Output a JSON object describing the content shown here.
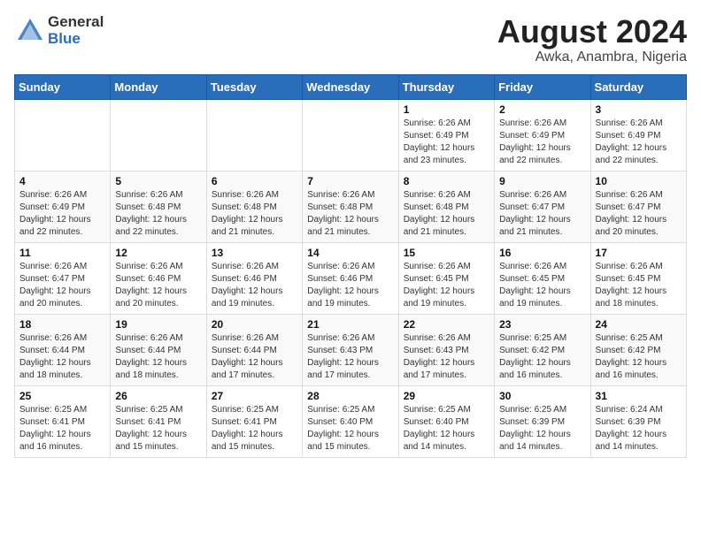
{
  "header": {
    "logo_general": "General",
    "logo_blue": "Blue",
    "title": "August 2024",
    "subtitle": "Awka, Anambra, Nigeria"
  },
  "days_of_week": [
    "Sunday",
    "Monday",
    "Tuesday",
    "Wednesday",
    "Thursday",
    "Friday",
    "Saturday"
  ],
  "weeks": [
    [
      {
        "day": "",
        "info": ""
      },
      {
        "day": "",
        "info": ""
      },
      {
        "day": "",
        "info": ""
      },
      {
        "day": "",
        "info": ""
      },
      {
        "day": "1",
        "info": "Sunrise: 6:26 AM\nSunset: 6:49 PM\nDaylight: 12 hours\nand 23 minutes."
      },
      {
        "day": "2",
        "info": "Sunrise: 6:26 AM\nSunset: 6:49 PM\nDaylight: 12 hours\nand 22 minutes."
      },
      {
        "day": "3",
        "info": "Sunrise: 6:26 AM\nSunset: 6:49 PM\nDaylight: 12 hours\nand 22 minutes."
      }
    ],
    [
      {
        "day": "4",
        "info": "Sunrise: 6:26 AM\nSunset: 6:49 PM\nDaylight: 12 hours\nand 22 minutes."
      },
      {
        "day": "5",
        "info": "Sunrise: 6:26 AM\nSunset: 6:48 PM\nDaylight: 12 hours\nand 22 minutes."
      },
      {
        "day": "6",
        "info": "Sunrise: 6:26 AM\nSunset: 6:48 PM\nDaylight: 12 hours\nand 21 minutes."
      },
      {
        "day": "7",
        "info": "Sunrise: 6:26 AM\nSunset: 6:48 PM\nDaylight: 12 hours\nand 21 minutes."
      },
      {
        "day": "8",
        "info": "Sunrise: 6:26 AM\nSunset: 6:48 PM\nDaylight: 12 hours\nand 21 minutes."
      },
      {
        "day": "9",
        "info": "Sunrise: 6:26 AM\nSunset: 6:47 PM\nDaylight: 12 hours\nand 21 minutes."
      },
      {
        "day": "10",
        "info": "Sunrise: 6:26 AM\nSunset: 6:47 PM\nDaylight: 12 hours\nand 20 minutes."
      }
    ],
    [
      {
        "day": "11",
        "info": "Sunrise: 6:26 AM\nSunset: 6:47 PM\nDaylight: 12 hours\nand 20 minutes."
      },
      {
        "day": "12",
        "info": "Sunrise: 6:26 AM\nSunset: 6:46 PM\nDaylight: 12 hours\nand 20 minutes."
      },
      {
        "day": "13",
        "info": "Sunrise: 6:26 AM\nSunset: 6:46 PM\nDaylight: 12 hours\nand 19 minutes."
      },
      {
        "day": "14",
        "info": "Sunrise: 6:26 AM\nSunset: 6:46 PM\nDaylight: 12 hours\nand 19 minutes."
      },
      {
        "day": "15",
        "info": "Sunrise: 6:26 AM\nSunset: 6:45 PM\nDaylight: 12 hours\nand 19 minutes."
      },
      {
        "day": "16",
        "info": "Sunrise: 6:26 AM\nSunset: 6:45 PM\nDaylight: 12 hours\nand 19 minutes."
      },
      {
        "day": "17",
        "info": "Sunrise: 6:26 AM\nSunset: 6:45 PM\nDaylight: 12 hours\nand 18 minutes."
      }
    ],
    [
      {
        "day": "18",
        "info": "Sunrise: 6:26 AM\nSunset: 6:44 PM\nDaylight: 12 hours\nand 18 minutes."
      },
      {
        "day": "19",
        "info": "Sunrise: 6:26 AM\nSunset: 6:44 PM\nDaylight: 12 hours\nand 18 minutes."
      },
      {
        "day": "20",
        "info": "Sunrise: 6:26 AM\nSunset: 6:44 PM\nDaylight: 12 hours\nand 17 minutes."
      },
      {
        "day": "21",
        "info": "Sunrise: 6:26 AM\nSunset: 6:43 PM\nDaylight: 12 hours\nand 17 minutes."
      },
      {
        "day": "22",
        "info": "Sunrise: 6:26 AM\nSunset: 6:43 PM\nDaylight: 12 hours\nand 17 minutes."
      },
      {
        "day": "23",
        "info": "Sunrise: 6:25 AM\nSunset: 6:42 PM\nDaylight: 12 hours\nand 16 minutes."
      },
      {
        "day": "24",
        "info": "Sunrise: 6:25 AM\nSunset: 6:42 PM\nDaylight: 12 hours\nand 16 minutes."
      }
    ],
    [
      {
        "day": "25",
        "info": "Sunrise: 6:25 AM\nSunset: 6:41 PM\nDaylight: 12 hours\nand 16 minutes."
      },
      {
        "day": "26",
        "info": "Sunrise: 6:25 AM\nSunset: 6:41 PM\nDaylight: 12 hours\nand 15 minutes."
      },
      {
        "day": "27",
        "info": "Sunrise: 6:25 AM\nSunset: 6:41 PM\nDaylight: 12 hours\nand 15 minutes."
      },
      {
        "day": "28",
        "info": "Sunrise: 6:25 AM\nSunset: 6:40 PM\nDaylight: 12 hours\nand 15 minutes."
      },
      {
        "day": "29",
        "info": "Sunrise: 6:25 AM\nSunset: 6:40 PM\nDaylight: 12 hours\nand 14 minutes."
      },
      {
        "day": "30",
        "info": "Sunrise: 6:25 AM\nSunset: 6:39 PM\nDaylight: 12 hours\nand 14 minutes."
      },
      {
        "day": "31",
        "info": "Sunrise: 6:24 AM\nSunset: 6:39 PM\nDaylight: 12 hours\nand 14 minutes."
      }
    ]
  ]
}
